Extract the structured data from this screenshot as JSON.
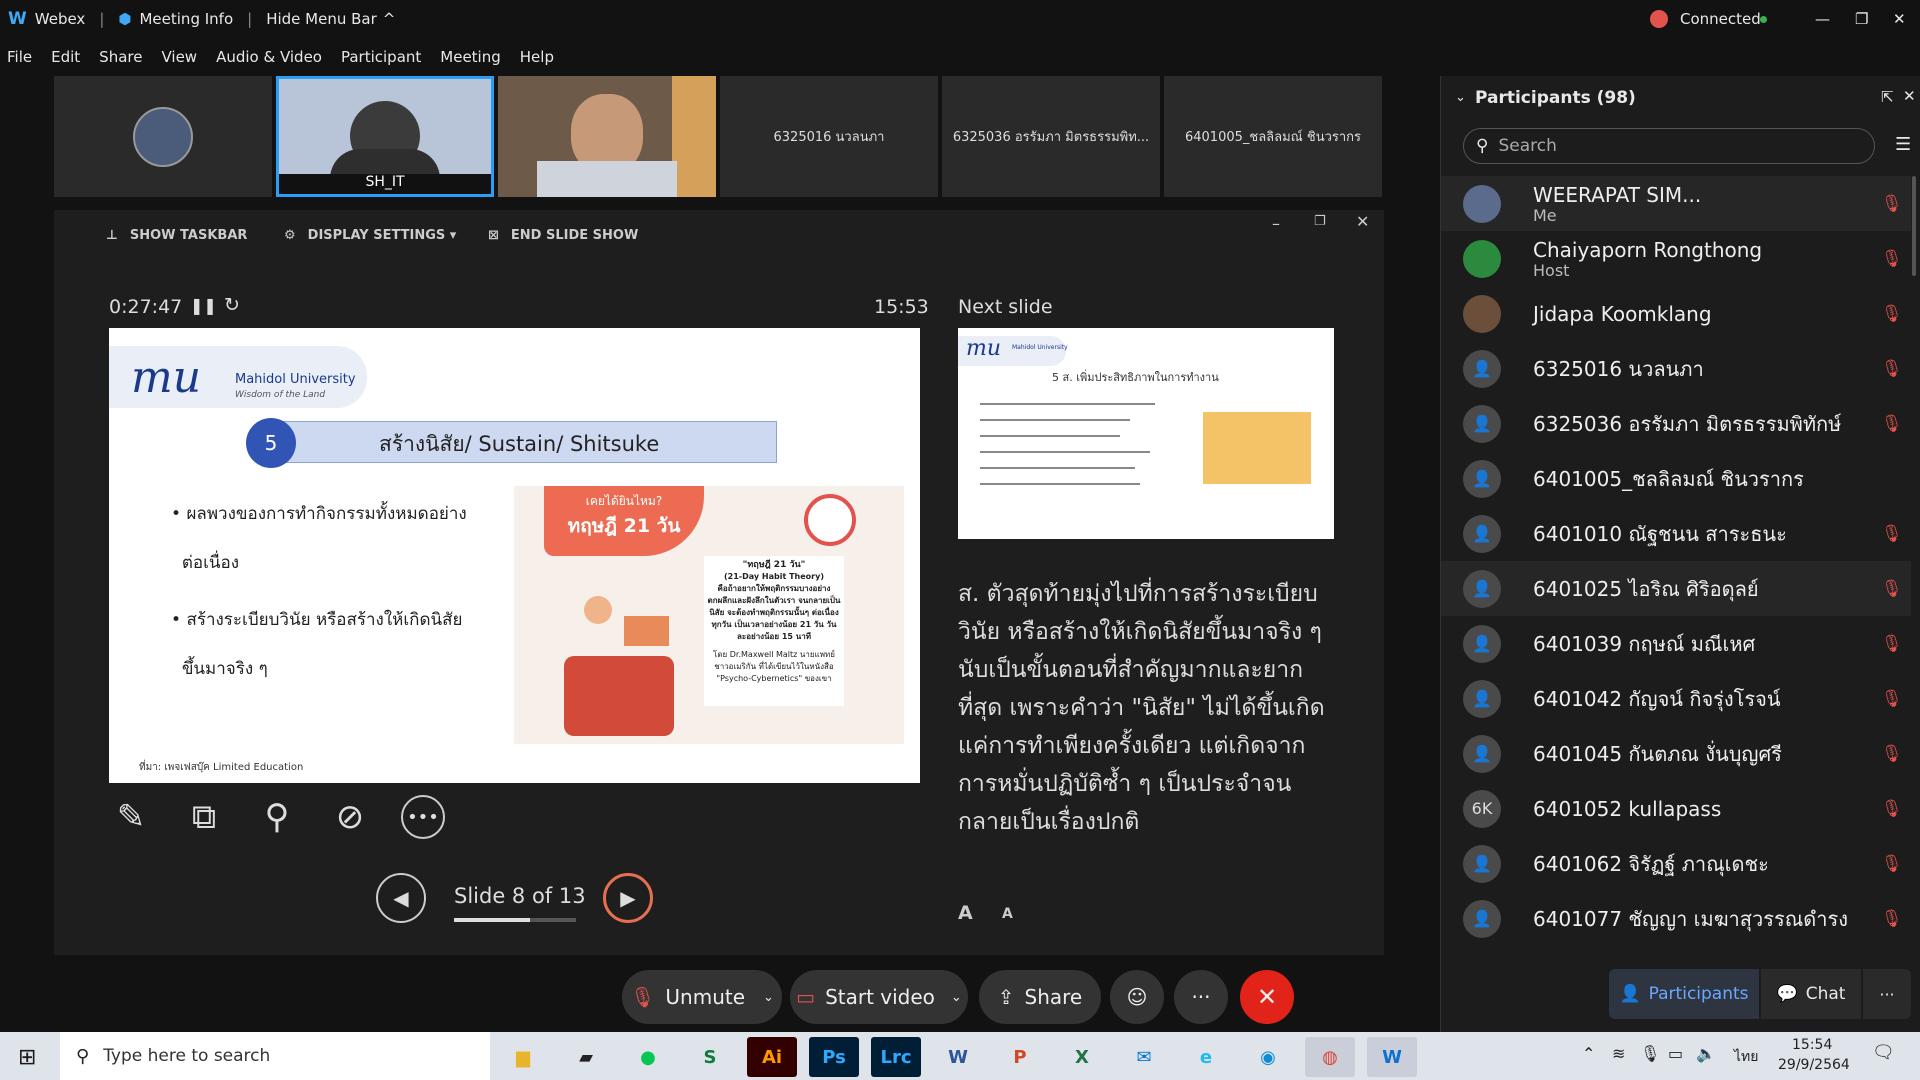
{
  "titlebar": {
    "app": "Webex",
    "meeting_info": "Meeting Info",
    "hide_menu": "Hide Menu Bar",
    "status": "Connected"
  },
  "menu": [
    "File",
    "Edit",
    "Share",
    "View",
    "Audio & Video",
    "Participant",
    "Meeting",
    "Help"
  ],
  "thumbnails": [
    "",
    "SH_IT",
    "",
    "6325016 นวลนภา",
    "6325036 อรรัมภา มิตรธรรมพิท...",
    "6401005_ชลลิลมณ์ ชินวรากร"
  ],
  "slideshow": {
    "show_taskbar": "SHOW TASKBAR",
    "display_settings": "DISPLAY SETTINGS ▾",
    "end_show": "END SLIDE SHOW",
    "elapsed": "0:27:47",
    "clock": "15:53",
    "next_label": "Next slide",
    "slide_counter": "Slide 8 of 13",
    "progress": 0.62
  },
  "slide": {
    "logo": "Mahidol University",
    "logo_sub": "Wisdom of the Land",
    "number": "5",
    "heading": "สร้างนิสัย/ Sustain/ Shitsuke",
    "bullet1a": "ผลพวงของการทำกิจกรรมทั้งหมดอย่าง",
    "bullet1b": "ต่อเนื่อง",
    "bullet2a": "สร้างระเบียบวินัย หรือสร้างให้เกิดนิสัย",
    "bullet2b": "ขึ้นมาจริง ๆ",
    "badge_a": "เคยได้ยินไหม?",
    "badge_b": "ทฤษฎี 21 วัน",
    "theory_title": "\"ทฤษฎี 21 วัน\"",
    "theory_sub": "(21-Day Habit Theory)",
    "theory_body": "คือถ้าอยากให้พฤติกรรมบางอย่างตกผลึกและฝังลึกในตัวเรา จนกลายเป็นนิสัย จะต้องทำพฤติกรรมนั้นๆ ต่อเนื่องทุกวัน เป็นเวลาอย่างน้อย 21 วัน วันละอย่างน้อย 15 นาที",
    "theory_author": "โดย Dr.Maxwell Maltz นายแพทย์ชาวอเมริกัน ที่ได้เขียนไว้ในหนังสือ \"Psycho-Cybernetics\" ของเขา",
    "source": "ที่มา: เพจเฟสบุ๊ค Limited Education"
  },
  "next_slide": {
    "logo": "Mahidol University",
    "heading": "5 ส. เพิ่มประสิทธิภาพในการทำงาน"
  },
  "notes": "ส. ตัวสุดท้ายมุ่งไปที่การสร้างระเบียบวินัย หรือสร้างให้เกิดนิสัยขึ้นมาจริง ๆ นับเป็นขั้นตอนที่สำคัญมากและยากที่สุด เพราะคำว่า \"นิสัย\" ไม่ได้ขึ้นเกิดแค่การทำเพียงครั้งเดียว แต่เกิดจากการหมั่นปฏิบัติซ้ำ ๆ เป็นประจำจนกลายเป็นเรื่องปกติ",
  "controls": {
    "unmute": "Unmute",
    "start_video": "Start video",
    "share": "Share"
  },
  "participants": {
    "title": "Participants (98)",
    "search_placeholder": "Search",
    "list": [
      {
        "name": "WEERAPAT SIM...",
        "sub": "Me",
        "avatar": ""
      },
      {
        "name": "Chaiyaporn Rongthong",
        "sub": "Host",
        "avatar": ""
      },
      {
        "name": "Jidapa Koomklang",
        "sub": "",
        "avatar": ""
      },
      {
        "name": "6325016 นวลนภา",
        "sub": "",
        "avatar": ""
      },
      {
        "name": "6325036 อรรัมภา มิตรธรรมพิทักษ์",
        "sub": "",
        "avatar": ""
      },
      {
        "name": "6401005_ชลลิลมณ์ ชินวรากร",
        "sub": "",
        "avatar": ""
      },
      {
        "name": "6401010 ณัฐชนน สาระธนะ",
        "sub": "",
        "avatar": ""
      },
      {
        "name": "6401025 ไอริณ ศิริอดุลย์",
        "sub": "",
        "avatar": ""
      },
      {
        "name": "6401039 กฤษณ์ มณีเหศ",
        "sub": "",
        "avatar": ""
      },
      {
        "name": "6401042 กัญจน์ กิจรุ่งโรจน์",
        "sub": "",
        "avatar": ""
      },
      {
        "name": "6401045 กันตภณ งั่นบุญศรี",
        "sub": "",
        "avatar": ""
      },
      {
        "name": "6401052 kullapass",
        "sub": "",
        "avatar": "6K"
      },
      {
        "name": "6401062 จิรัฏฐ์ ภาณุเดชะ",
        "sub": "",
        "avatar": ""
      },
      {
        "name": "6401077 ชัญญา เมฆาสุวรรณดำรง",
        "sub": "",
        "avatar": ""
      }
    ],
    "tab_participants": "Participants",
    "tab_chat": "Chat"
  },
  "taskbar": {
    "search_placeholder": "Type here to search",
    "time": "15:54",
    "date": "29/9/2564",
    "lang": "ไทย"
  }
}
